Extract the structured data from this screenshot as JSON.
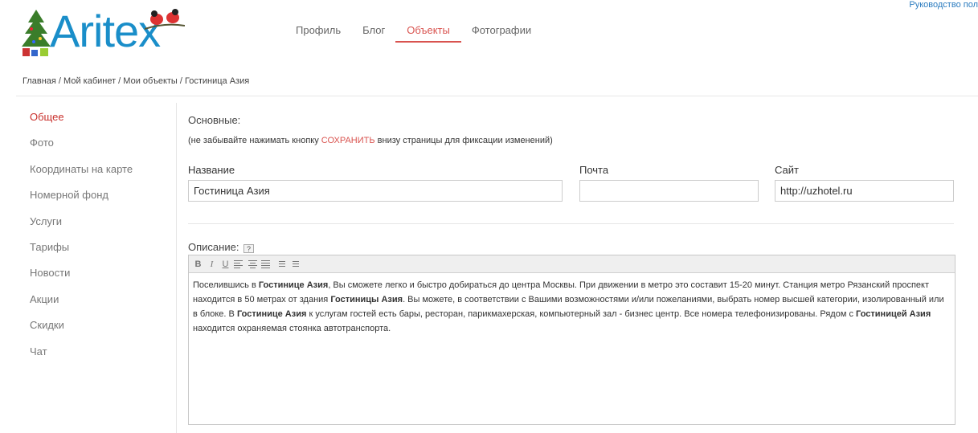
{
  "top_link": "Руководство пол",
  "logo": {
    "text": "Aritex"
  },
  "nav": [
    {
      "label": "Профиль",
      "active": false
    },
    {
      "label": "Блог",
      "active": false
    },
    {
      "label": "Объекты",
      "active": true
    },
    {
      "label": "Фотографии",
      "active": false
    }
  ],
  "breadcrumb": "Главная / Мой кабинет / Мои объекты / Гостиница Азия",
  "sidebar": {
    "items": [
      {
        "label": "Общее",
        "active": true
      },
      {
        "label": "Фото"
      },
      {
        "label": "Координаты на карте"
      },
      {
        "label": "Номерной фонд"
      },
      {
        "label": "Услуги"
      },
      {
        "label": "Тарифы"
      },
      {
        "label": "Новости"
      },
      {
        "label": "Акции"
      },
      {
        "label": "Скидки"
      },
      {
        "label": "Чат"
      }
    ]
  },
  "main": {
    "section_title": "Основные:",
    "hint_before": "(не забывайте нажимать кнопку ",
    "hint_button": "СОХРАНИТЬ",
    "hint_after": " внизу страницы для фиксации изменений)",
    "fields": {
      "name": {
        "label": "Название",
        "value": "Гостиница Азия"
      },
      "email": {
        "label": "Почта",
        "value": ""
      },
      "site": {
        "label": "Сайт",
        "value": "http://uzhotel.ru"
      }
    },
    "description": {
      "label": "Описание:",
      "help": "?",
      "toolbar": [
        "B",
        "I",
        "U",
        "align-left",
        "align-center",
        "align-justify",
        "ordered-list",
        "unordered-list"
      ],
      "segments": [
        {
          "text": "Поселившись в ",
          "bold": false
        },
        {
          "text": "Гостинице Азия",
          "bold": true
        },
        {
          "text": ", Вы сможете легко и быстро добираться до центра Москвы. При движении в метро это составит 15-20 минут. Станция метро Рязанский проспект находится в 50 метрах от здания ",
          "bold": false
        },
        {
          "text": "Гостиницы Азия",
          "bold": true
        },
        {
          "text": ". Вы можете, в соответствии с Вашими возможностями и/или пожеланиями, выбрать номер высшей категории, изолированный или в блоке. В ",
          "bold": false
        },
        {
          "text": "Гостинице Азия",
          "bold": true
        },
        {
          "text": " к услугам гостей есть бары, ресторан, парикмахерская, компьютерный зал - бизнес центр. Все номера телефонизированы. Рядом с ",
          "bold": false
        },
        {
          "text": "Гостиницей Азия",
          "bold": true
        },
        {
          "text": " находится охраняемая стоянка автотранспорта.",
          "bold": false
        }
      ]
    }
  },
  "colors": {
    "accent": "#d9534f",
    "brand": "#1a8ec9",
    "link": "#2a7bbf"
  }
}
